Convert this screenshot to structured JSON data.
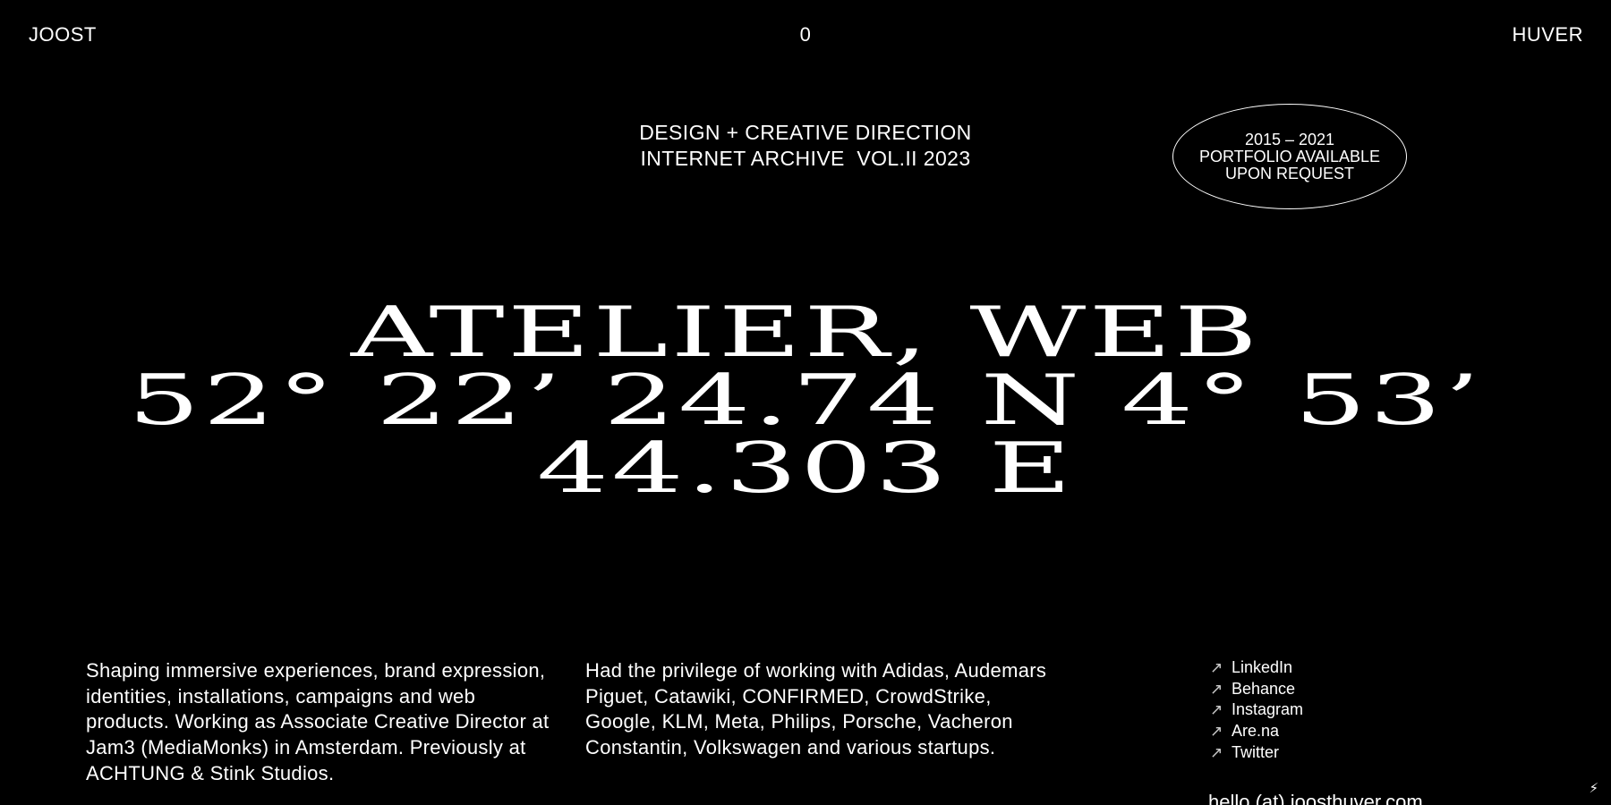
{
  "header": {
    "left": "JOOST",
    "center": "0",
    "right": "HUVER"
  },
  "subtitle": {
    "line1": "DESIGN + CREATIVE DIRECTION",
    "line2": "INTERNET ARCHIVE  VOL.II 2023"
  },
  "badge": {
    "line1": "2015 – 2021",
    "line2": "PORTFOLIO AVAILABLE",
    "line3": "UPON REQUEST"
  },
  "headline": {
    "line1": "ATELIER, WEB",
    "line2": "52° 22’ 24.74 N 4° 53’",
    "line3": "44.303 E"
  },
  "about": {
    "text": "Shaping immersive experiences, brand expression, identities, installations, campaigns and web products. Working as Associate Creative Director at Jam3 (MediaMonks) in Amsterdam. Previously at ACHTUNG & Stink Studios."
  },
  "clients": {
    "text": "Had the privilege of working with Adidas, Audemars Piguet, Catawiki, CONFIRMED, CrowdStrike, Google, KLM, Meta, Philips, Porsche, Vacheron Constantin, Volkswagen and various startups."
  },
  "links": [
    {
      "label": "LinkedIn",
      "icon": "arrow-up-right-icon"
    },
    {
      "label": "Behance",
      "icon": "arrow-up-right-icon"
    },
    {
      "label": "Instagram",
      "icon": "arrow-up-right-icon"
    },
    {
      "label": "Are.na",
      "icon": "arrow-up-right-icon"
    },
    {
      "label": "Twitter",
      "icon": "arrow-up-right-icon"
    }
  ],
  "email": "hello (at) joosthuver.com",
  "icons": {
    "link_arrow": "↗",
    "bolt": "⚡"
  },
  "colors": {
    "background": "#000000",
    "text": "#ffffff"
  }
}
